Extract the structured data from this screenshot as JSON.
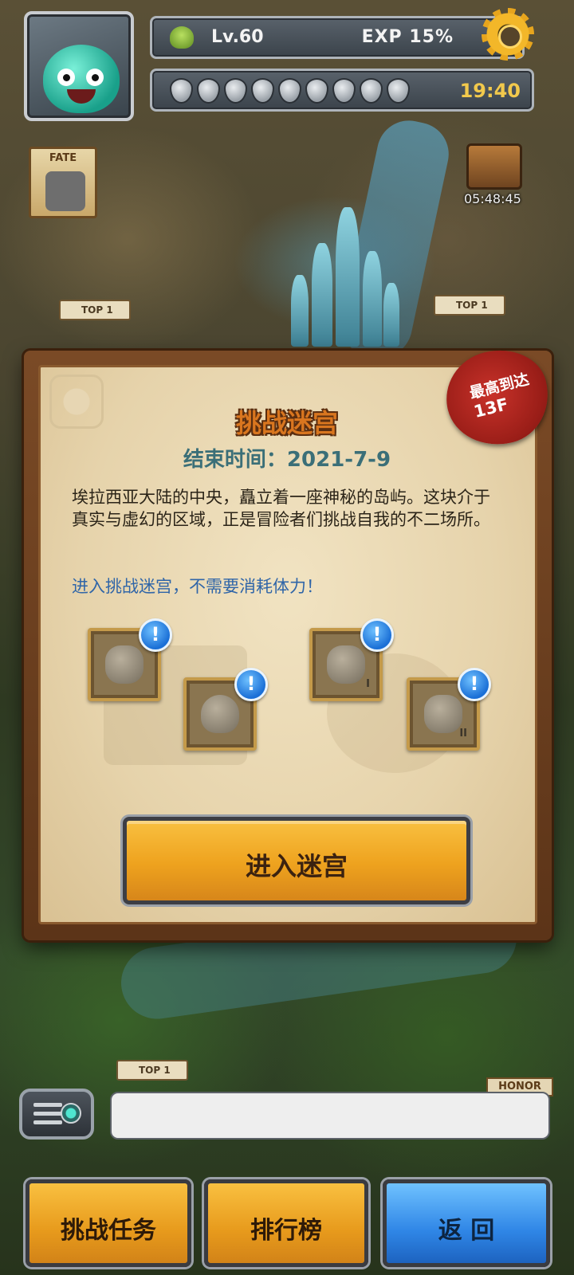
{
  "hud": {
    "level": "Lv.60",
    "exp": "EXP 15%",
    "stamina_count": 9,
    "timer": "19:40"
  },
  "map": {
    "fate_label": "FATE",
    "chest_timer": "05:48:45",
    "top_label": "TOP 1",
    "honor_label": "HONOR"
  },
  "panel": {
    "title": "挑战迷宫",
    "end_time": "结束时间：2021-7-9",
    "description": "埃拉西亚大陆的中央，矗立着一座神秘的岛屿。这块介于真实与虚幻的区域，正是冒险者们挑战自我的不二场所。",
    "no_stamina_note": "进入挑战迷宫，不需要消耗体力！",
    "seal_line1": "最高到达",
    "seal_line2": "13F",
    "enter_button": "进入迷宫",
    "reward_alert_symbol": "!",
    "reward_slots": [
      {
        "icon": "urn-icon",
        "mark": ""
      },
      {
        "icon": "leaf-shield-icon",
        "mark": ""
      },
      {
        "icon": "slime-i-icon",
        "mark": "I"
      },
      {
        "icon": "slime-ii-icon",
        "mark": "II"
      }
    ]
  },
  "bottom": {
    "challenge_tasks": "挑战任务",
    "leaderboard": "排行榜",
    "back": "返 回"
  },
  "colors": {
    "accent_orange": "#eea21e",
    "accent_blue": "#2f86e6",
    "title_orange": "#d9761f",
    "note_blue": "#2f65a8",
    "seal_red": "#9b1e18"
  }
}
